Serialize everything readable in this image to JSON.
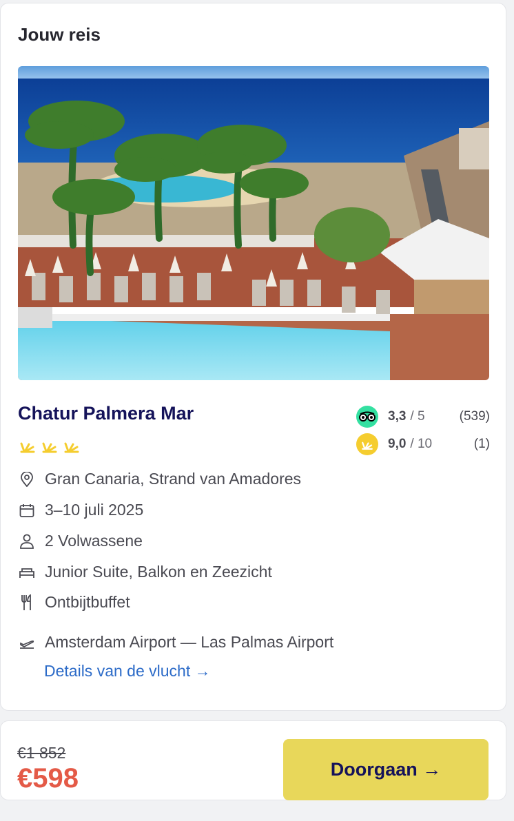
{
  "trip": {
    "title": "Jouw reis",
    "hotel_name": "Chatur Palmera Mar",
    "stars": 3,
    "ratings": {
      "tripadvisor": {
        "score": "3,3",
        "out_of": "/ 5",
        "count": "(539)",
        "color": "#34e0a1"
      },
      "sunweb": {
        "score": "9,0",
        "out_of": "/ 10",
        "count": "(1)",
        "color": "#f5cd2f"
      }
    },
    "details": {
      "location": "Gran Canaria, Strand van Amadores",
      "dates": "3–10 juli 2025",
      "travellers": "2 Volwassene",
      "room": "Junior Suite, Balkon en Zeezicht",
      "board": "Ontbijtbuffet",
      "flight": "Amsterdam Airport — Las Palmas Airport",
      "flight_link": "Details van de vlucht →"
    }
  },
  "price": {
    "old": "€1 852",
    "new": "€598",
    "cta_label": "Doorgaan →"
  },
  "colors": {
    "brand_navy": "#15135a",
    "price_red": "#e45a47",
    "cta_yellow": "#e8d75a",
    "link_blue": "#2c6bc8",
    "star_yellow": "#f5cd2f"
  }
}
